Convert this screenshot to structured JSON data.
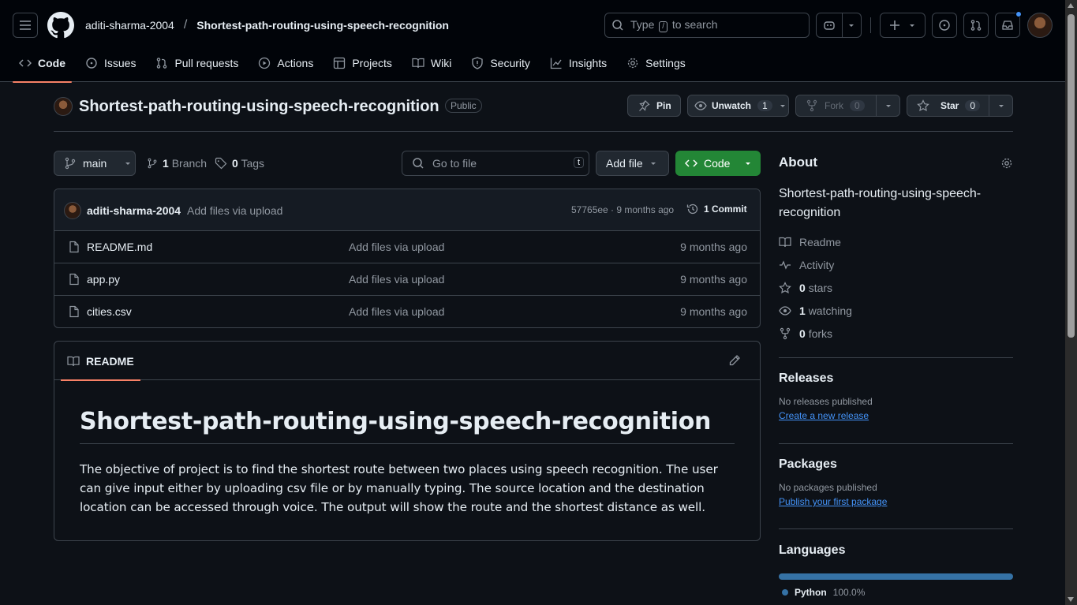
{
  "header": {
    "owner": "aditi-sharma-2004",
    "separator": "/",
    "repo": "Shortest-path-routing-using-speech-recognition",
    "search_before": "Type",
    "search_key": "/",
    "search_after": "to search"
  },
  "nav": {
    "tabs": [
      {
        "label": "Code"
      },
      {
        "label": "Issues"
      },
      {
        "label": "Pull requests"
      },
      {
        "label": "Actions"
      },
      {
        "label": "Projects"
      },
      {
        "label": "Wiki"
      },
      {
        "label": "Security"
      },
      {
        "label": "Insights"
      },
      {
        "label": "Settings"
      }
    ]
  },
  "repo": {
    "title": "Shortest-path-routing-using-speech-recognition",
    "visibility": "Public",
    "pin_label": "Pin",
    "unwatch_label": "Unwatch",
    "watch_count": "1",
    "fork_label": "Fork",
    "fork_count": "0",
    "star_label": "Star",
    "star_count": "0"
  },
  "toolbar": {
    "branch": "main",
    "branch_count": "1",
    "branch_label": "Branch",
    "tag_count": "0",
    "tag_label": "Tags",
    "goto_placeholder": "Go to file",
    "goto_key": "t",
    "add_file": "Add file",
    "code": "Code"
  },
  "commit": {
    "author": "aditi-sharma-2004",
    "message": "Add files via upload",
    "hash_time": "57765ee · 9 months ago",
    "commits": "1 Commit"
  },
  "files": [
    {
      "name": "README.md",
      "message": "Add files via upload",
      "age": "9 months ago"
    },
    {
      "name": "app.py",
      "message": "Add files via upload",
      "age": "9 months ago"
    },
    {
      "name": "cities.csv",
      "message": "Add files via upload",
      "age": "9 months ago"
    }
  ],
  "readme": {
    "tab": "README",
    "heading": "Shortest-path-routing-using-speech-recognition",
    "body": "The objective of project is to find the shortest route between two places using speech recognition. The user can give input either by uploading csv file or by manually typing. The source location and the destination location can be accessed through voice. The output will show the route and the shortest distance as well."
  },
  "about": {
    "title": "About",
    "description": "Shortest-path-routing-using-speech-recognition",
    "readme": "Readme",
    "activity": "Activity",
    "stars_count": "0",
    "stars_label": "stars",
    "watching_count": "1",
    "watching_label": "watching",
    "forks_count": "0",
    "forks_label": "forks"
  },
  "releases": {
    "title": "Releases",
    "none": "No releases published",
    "link": "Create a new release"
  },
  "packages": {
    "title": "Packages",
    "none": "No packages published",
    "link": "Publish your first package"
  },
  "languages": {
    "title": "Languages",
    "items": [
      {
        "name": "Python",
        "percent": "100.0%",
        "color": "#3572A5",
        "share": 1.0
      }
    ]
  },
  "colors": {
    "accent_tab": "#f78166",
    "primary_button": "#238636",
    "link": "#4493f8"
  }
}
